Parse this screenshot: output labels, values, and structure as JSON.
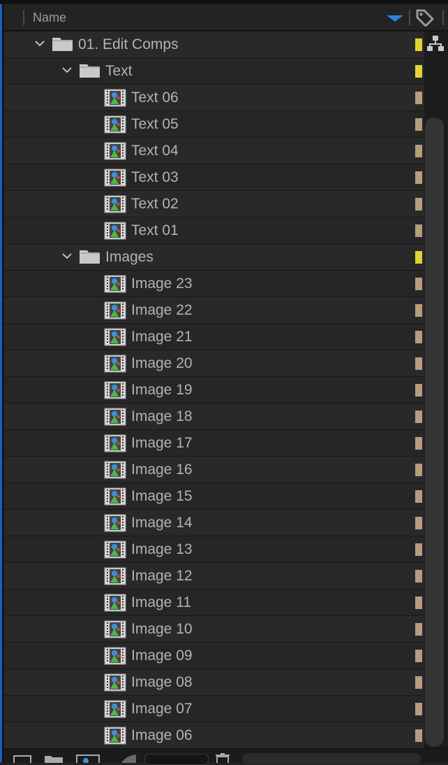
{
  "header": {
    "name_label": "Name"
  },
  "colors": {
    "folder_label": "#e2d335",
    "item_label": "#b69d7d",
    "sort_arrow": "#2f7fe0"
  },
  "rows": [
    {
      "label": "01. Edit Comps",
      "kind": "folder",
      "depth": 0,
      "expanded": true,
      "label_color": "yellow"
    },
    {
      "label": "Text",
      "kind": "folder",
      "depth": 1,
      "expanded": true,
      "label_color": "yellow"
    },
    {
      "label": "Text 06",
      "kind": "comp",
      "depth": 2,
      "label_color": "sandstone"
    },
    {
      "label": "Text 05",
      "kind": "comp",
      "depth": 2,
      "label_color": "sandstone"
    },
    {
      "label": "Text 04",
      "kind": "comp",
      "depth": 2,
      "label_color": "sandstone"
    },
    {
      "label": "Text 03",
      "kind": "comp",
      "depth": 2,
      "label_color": "sandstone"
    },
    {
      "label": "Text 02",
      "kind": "comp",
      "depth": 2,
      "label_color": "sandstone"
    },
    {
      "label": "Text 01",
      "kind": "comp",
      "depth": 2,
      "label_color": "sandstone"
    },
    {
      "label": "Images",
      "kind": "folder",
      "depth": 1,
      "expanded": true,
      "label_color": "yellow"
    },
    {
      "label": "Image 23",
      "kind": "comp",
      "depth": 2,
      "label_color": "sandstone"
    },
    {
      "label": "Image 22",
      "kind": "comp",
      "depth": 2,
      "label_color": "sandstone"
    },
    {
      "label": "Image 21",
      "kind": "comp",
      "depth": 2,
      "label_color": "sandstone"
    },
    {
      "label": "Image 20",
      "kind": "comp",
      "depth": 2,
      "label_color": "sandstone"
    },
    {
      "label": "Image 19",
      "kind": "comp",
      "depth": 2,
      "label_color": "sandstone"
    },
    {
      "label": "Image 18",
      "kind": "comp",
      "depth": 2,
      "label_color": "sandstone"
    },
    {
      "label": "Image 17",
      "kind": "comp",
      "depth": 2,
      "label_color": "sandstone"
    },
    {
      "label": "Image 16",
      "kind": "comp",
      "depth": 2,
      "label_color": "sandstone"
    },
    {
      "label": "Image 15",
      "kind": "comp",
      "depth": 2,
      "label_color": "sandstone"
    },
    {
      "label": "Image 14",
      "kind": "comp",
      "depth": 2,
      "label_color": "sandstone"
    },
    {
      "label": "Image 13",
      "kind": "comp",
      "depth": 2,
      "label_color": "sandstone"
    },
    {
      "label": "Image 12",
      "kind": "comp",
      "depth": 2,
      "label_color": "sandstone"
    },
    {
      "label": "Image 11",
      "kind": "comp",
      "depth": 2,
      "label_color": "sandstone"
    },
    {
      "label": "Image 10",
      "kind": "comp",
      "depth": 2,
      "label_color": "sandstone"
    },
    {
      "label": "Image 09",
      "kind": "comp",
      "depth": 2,
      "label_color": "sandstone"
    },
    {
      "label": "Image 08",
      "kind": "comp",
      "depth": 2,
      "label_color": "sandstone"
    },
    {
      "label": "Image 07",
      "kind": "comp",
      "depth": 2,
      "label_color": "sandstone"
    },
    {
      "label": "Image 06",
      "kind": "comp",
      "depth": 2,
      "label_color": "sandstone"
    }
  ],
  "icons": {
    "header_tag": "tag-icon",
    "header_sort": "sort-descending-icon",
    "side_flowchart": "flowchart-icon",
    "footer": [
      "interpret-footage-icon",
      "new-folder-icon",
      "new-composition-icon",
      "color-depth-icon",
      "trash-icon"
    ]
  }
}
